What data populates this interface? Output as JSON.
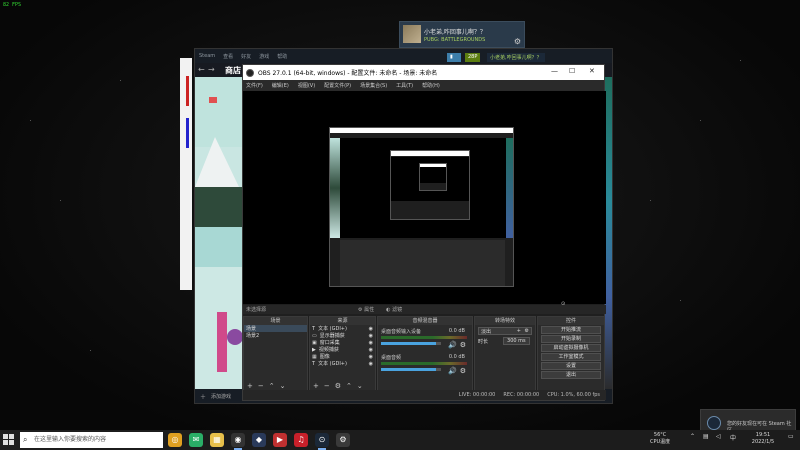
{
  "overlay": {
    "fps": "82 FPS"
  },
  "steam_notification": {
    "name": "小老弟,咋回事儿啊？？",
    "game": "PUBG: BATTLEGROUNDS",
    "gear_icon": "gear-icon"
  },
  "steam": {
    "menu": [
      "Steam",
      "查看",
      "好友",
      "游戏",
      "帮助"
    ],
    "page_title": "商店",
    "nav_icons": [
      "back-icon",
      "forward-icon"
    ],
    "points_label": "28P",
    "user_label": "小老弟,咋回事儿啊？？",
    "add_game_label": "添加游戏",
    "accent": "#66c0f4"
  },
  "obs": {
    "title": "OBS 27.0.1 (64-bit, windows) - 配置文件: 未命名 - 场景: 未命名",
    "menu": [
      "文件(F)",
      "编辑(E)",
      "视图(V)",
      "配置文件(P)",
      "场景集合(S)",
      "工具(T)",
      "帮助(H)"
    ],
    "context_bar": {
      "no_source": "未选择源",
      "properties": "属性",
      "filters": "滤镜"
    },
    "docks": {
      "scenes": {
        "title": "场景",
        "items": [
          "场景",
          "场景2"
        ]
      },
      "sources": {
        "title": "来源",
        "items": [
          {
            "label": "文本 (GDI+)",
            "icon": "text-icon"
          },
          {
            "label": "显示器捕获",
            "icon": "monitor-icon"
          },
          {
            "label": "窗口采集",
            "icon": "window-icon"
          },
          {
            "label": "视频捕获",
            "icon": "camera-icon"
          },
          {
            "label": "图像",
            "icon": "image-icon"
          },
          {
            "label": "文本 (GDI+)",
            "icon": "text-icon"
          }
        ]
      },
      "mixer": {
        "title": "音频混音器",
        "channels": [
          {
            "name": "桌面音频输入设备",
            "db": "0.0 dB",
            "level": 0.92
          },
          {
            "name": "桌面音频",
            "db": "0.0 dB",
            "level": 0.92
          }
        ]
      },
      "transitions": {
        "title": "转场特效",
        "selected": "淡出",
        "duration_label": "时长",
        "duration": "300 ms"
      },
      "controls": {
        "title": "控件",
        "buttons": [
          "开始推流",
          "开始录制",
          "启动虚拟摄像机",
          "工作室模式",
          "设置",
          "退出"
        ]
      }
    },
    "status": {
      "live": "LIVE: 00:00:00",
      "rec": "REC: 00:00:00",
      "cpu": "CPU: 1.0%, 60.00 fps"
    }
  },
  "taskbar": {
    "search_placeholder": "在这里输入你要搜索的内容",
    "apps": [
      {
        "name": "chrome",
        "color": "#e0a020",
        "active": false
      },
      {
        "name": "wechat",
        "color": "#2aae67",
        "active": false
      },
      {
        "name": "files",
        "color": "#e8c04a",
        "active": false
      },
      {
        "name": "obs",
        "color": "#333333",
        "active": true
      },
      {
        "name": "unity",
        "color": "#2a3a5a",
        "active": false
      },
      {
        "name": "potplayer",
        "color": "#c03030",
        "active": false
      },
      {
        "name": "netease-music",
        "color": "#c8202a",
        "active": false
      },
      {
        "name": "steam",
        "color": "#1b2838",
        "active": true
      },
      {
        "name": "settings",
        "color": "#3a3a3a",
        "active": false
      }
    ],
    "weather": {
      "temp": "56°C",
      "label": "CPU温度"
    },
    "clock": {
      "time": "19:51",
      "date": "2022/1/5"
    }
  },
  "toast": {
    "text": "您的好友现在可在 Steam 社区..."
  }
}
